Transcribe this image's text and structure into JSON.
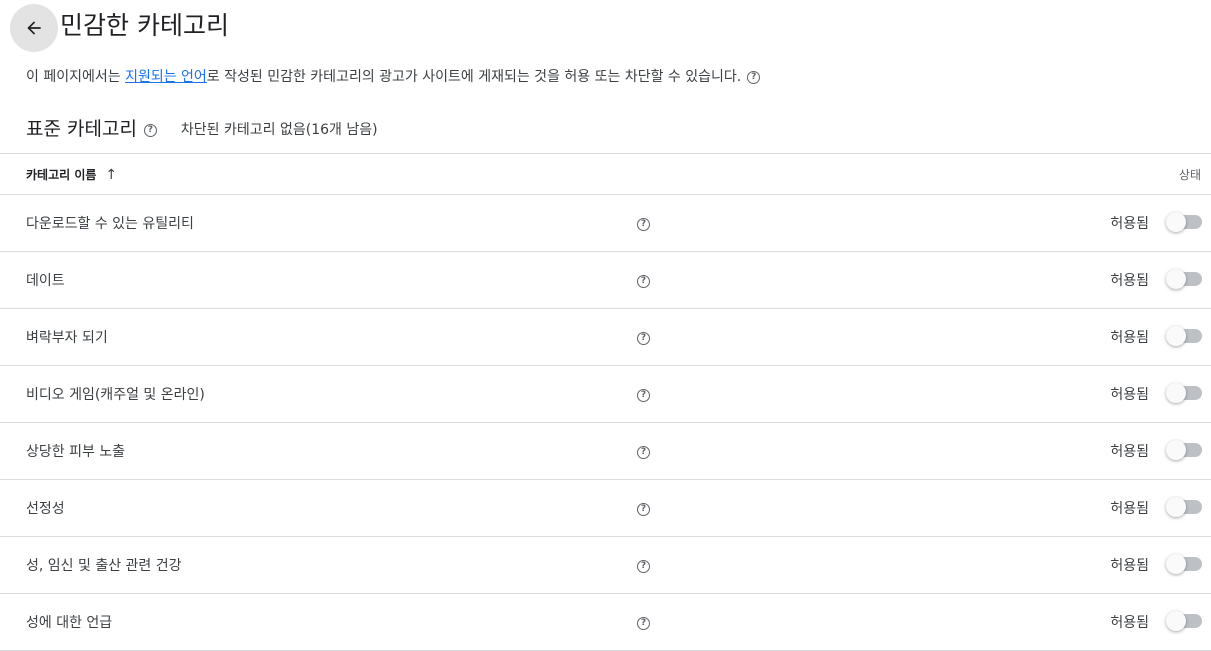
{
  "header": {
    "back_icon": "arrow-back-icon",
    "title": "민감한 카테고리"
  },
  "description": {
    "before_link": "이 페이지에서는 ",
    "link_text": "지원되는 언어",
    "after_link": "로 작성된 민감한 카테고리의 광고가 사이트에 게재되는 것을 허용 또는 차단할 수 있습니다.",
    "help_icon": "help-icon"
  },
  "section": {
    "title": "표준 카테고리",
    "status": "차단된 카테고리 없음(16개 남음)"
  },
  "table": {
    "col_name": "카테고리 이름",
    "sort_icon": "arrow-up-icon",
    "col_status": "상태",
    "rows": [
      {
        "name": "다운로드할 수 있는 유틸리티",
        "status": "허용됨",
        "blocked": false
      },
      {
        "name": "데이트",
        "status": "허용됨",
        "blocked": false
      },
      {
        "name": "벼락부자 되기",
        "status": "허용됨",
        "blocked": false
      },
      {
        "name": "비디오 게임(캐주얼 및 온라인)",
        "status": "허용됨",
        "blocked": false
      },
      {
        "name": "상당한 피부 노출",
        "status": "허용됨",
        "blocked": false
      },
      {
        "name": "선정성",
        "status": "허용됨",
        "blocked": false
      },
      {
        "name": "성, 임신 및 출산 관련 건강",
        "status": "허용됨",
        "blocked": false
      },
      {
        "name": "성에 대한 언급",
        "status": "허용됨",
        "blocked": false
      }
    ]
  },
  "colors": {
    "link": "#1a73e8",
    "toggle_off_track": "#bdc1c6",
    "divider": "#dadce0"
  }
}
